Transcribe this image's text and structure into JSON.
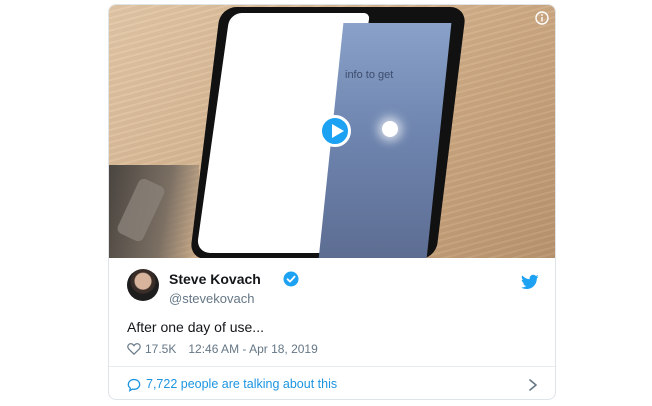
{
  "media": {
    "screen_text": "info to get",
    "play_label": "Play video"
  },
  "tweet": {
    "author_name": "Steve Kovach",
    "author_handle": "@stevekovach",
    "text": "After one day of use...",
    "likes": "17.5K",
    "timestamp": "12:46 AM - Apr 18, 2019",
    "talking": "7,722 people are talking about this"
  },
  "colors": {
    "brand": "#1da1f2",
    "link": "#1b95e0",
    "muted": "#657786",
    "text": "#14171a"
  },
  "icons": [
    "info-icon",
    "play-icon",
    "verified-badge-icon",
    "twitter-bird-icon",
    "heart-icon",
    "speech-bubble-icon",
    "chevron-right-icon"
  ]
}
